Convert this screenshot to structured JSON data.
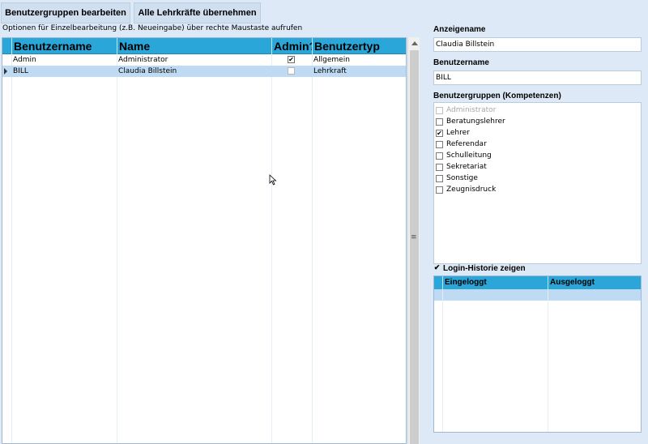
{
  "toolbar": {
    "edit_groups_label": "Benutzergruppen bearbeiten",
    "import_teachers_label": "Alle Lehrkräfte übernehmen"
  },
  "hint": "Optionen für Einzelbearbeitung (z.B. Neueingabe) über rechte Maustaste aufrufen",
  "grid": {
    "columns": [
      "Benutzername",
      "Name",
      "Admin?",
      "Benutzertyp"
    ],
    "rows": [
      {
        "username": "Admin",
        "name": "Administrator",
        "admin": true,
        "type": "Allgemein",
        "selected": false
      },
      {
        "username": "BILL",
        "name": "Claudia Billstein",
        "admin": false,
        "type": "Lehrkraft",
        "selected": true
      }
    ]
  },
  "details": {
    "display_name_label": "Anzeigename",
    "display_name_value": "Claudia Billstein",
    "username_label": "Benutzername",
    "username_value": "BILL",
    "groups_label": "Benutzergruppen (Kompetenzen)",
    "groups": [
      {
        "label": "Administrator",
        "checked": false,
        "disabled": true
      },
      {
        "label": "Beratungslehrer",
        "checked": false,
        "disabled": false
      },
      {
        "label": "Lehrer",
        "checked": true,
        "disabled": false
      },
      {
        "label": "Referendar",
        "checked": false,
        "disabled": false
      },
      {
        "label": "Schulleitung",
        "checked": false,
        "disabled": false
      },
      {
        "label": "Sekretariat",
        "checked": false,
        "disabled": false
      },
      {
        "label": "Sonstige",
        "checked": false,
        "disabled": false
      },
      {
        "label": "Zeugnisdruck",
        "checked": false,
        "disabled": false
      }
    ],
    "login_history_label": "Login-Historie zeigen",
    "login_history_checked": true,
    "history_columns": [
      "Eingeloggt",
      "Ausgeloggt"
    ]
  },
  "colors": {
    "header_blue": "#2aa6d9",
    "selection": "#bfdbf3",
    "background": "#dde9f7"
  }
}
